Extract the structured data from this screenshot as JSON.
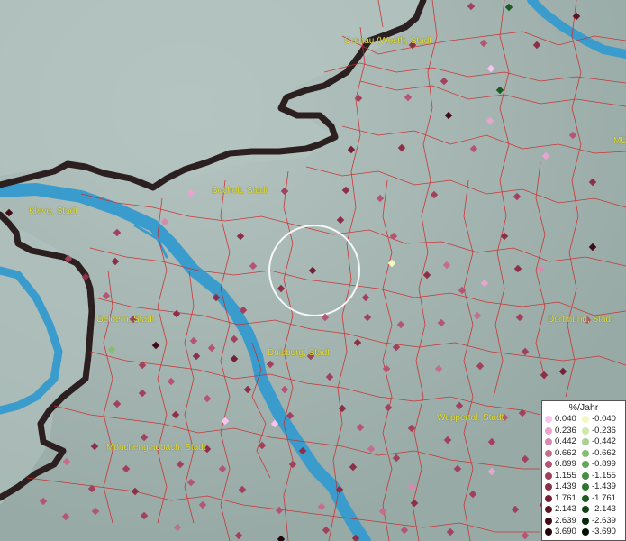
{
  "cities": [
    {
      "name": "Gronau (Westf), Stadt"
    },
    {
      "name": "MÜ"
    },
    {
      "name": "Bocholt, Stadt"
    },
    {
      "name": "Kleve, Stadt"
    },
    {
      "name": "Geldern, Stadt"
    },
    {
      "name": "Duisburg, Stadt"
    },
    {
      "name": "Dortmund, Stadt"
    },
    {
      "name": "Wuppertal, Stadt"
    },
    {
      "name": "Mönchengladbach, Stadt"
    }
  ],
  "legend": {
    "title": "%/Jahr",
    "positive": [
      {
        "label": "0.040",
        "color": "#f6c4ee"
      },
      {
        "label": "0.236",
        "color": "#e7a4cf"
      },
      {
        "label": "0.442",
        "color": "#d68aae"
      },
      {
        "label": "0.662",
        "color": "#c56d8f"
      },
      {
        "label": "0.899",
        "color": "#b45574"
      },
      {
        "label": "1.155",
        "color": "#a1415d"
      },
      {
        "label": "1.439",
        "color": "#8c2f48"
      },
      {
        "label": "1.761",
        "color": "#752035"
      },
      {
        "label": "2.143",
        "color": "#5c1424"
      },
      {
        "label": "2.639",
        "color": "#410b17"
      },
      {
        "label": "3.690",
        "color": "#22050a"
      }
    ],
    "negative": [
      {
        "label": "-0.040",
        "color": "#f3f7c2"
      },
      {
        "label": "-0.236",
        "color": "#cfe8ae"
      },
      {
        "label": "-0.442",
        "color": "#a8d38f"
      },
      {
        "label": "-0.662",
        "color": "#85bd72"
      },
      {
        "label": "-0.899",
        "color": "#64a658"
      },
      {
        "label": "-1.155",
        "color": "#468f42"
      },
      {
        "label": "-1.439",
        "color": "#2e7530"
      },
      {
        "label": "-1.761",
        "color": "#1d5c21"
      },
      {
        "label": "-2.143",
        "color": "#104315"
      },
      {
        "label": "-2.639",
        "color": "#072b0b"
      },
      {
        "label": "-3.690",
        "color": "#011404"
      }
    ]
  },
  "colors": {
    "land": "#a9b9b6",
    "water": "#3a9ccc",
    "boundary": "#cc2a2a",
    "border": "#2b1f1f",
    "label": "#e8e23a"
  }
}
